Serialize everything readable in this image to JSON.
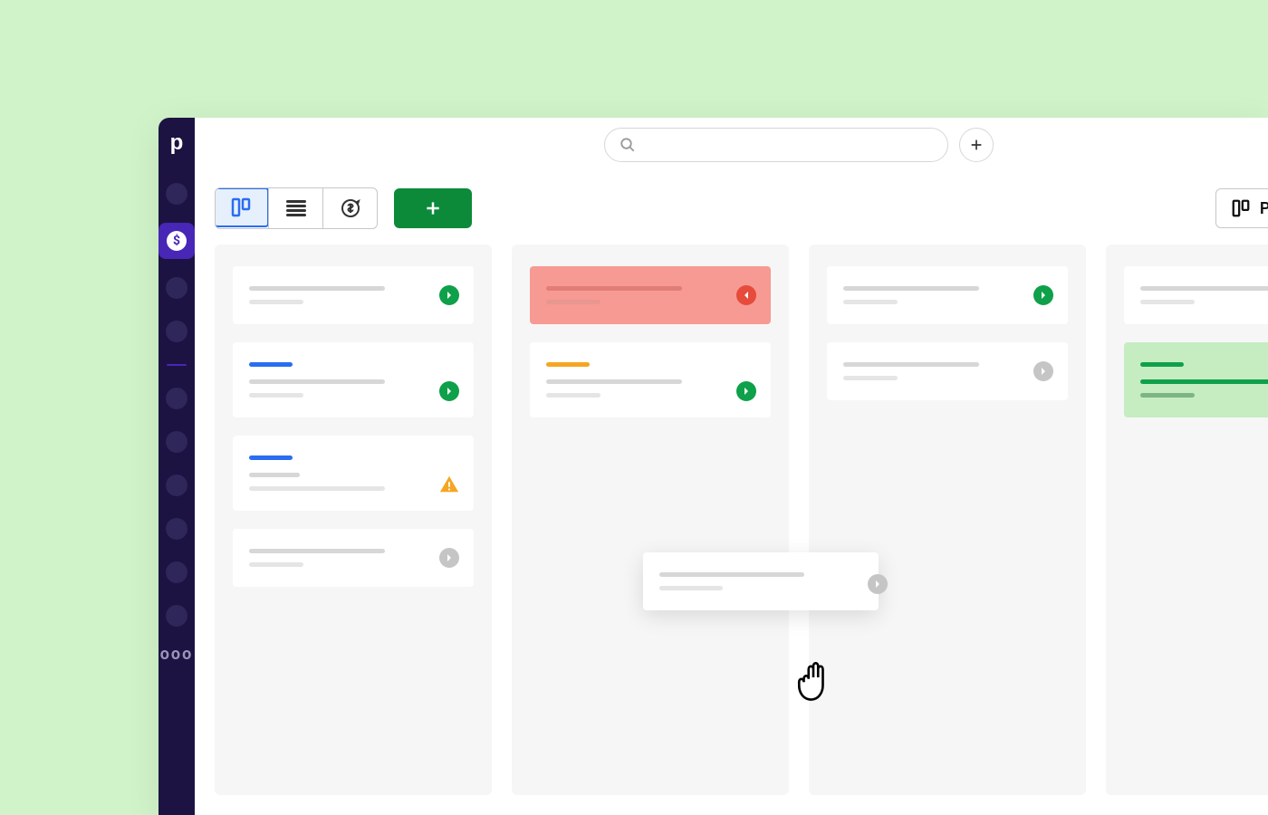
{
  "app": {
    "logo": "p"
  },
  "nav": {
    "active_icon_label": "$",
    "more": "ooo"
  },
  "search": {
    "placeholder": ""
  },
  "toolbar": {
    "pipeline_label": "Pipeline"
  },
  "columns": [
    {
      "cards": [
        {
          "type": "default",
          "title_w": 150,
          "sub_w": 60,
          "badge": "green"
        },
        {
          "type": "default",
          "accent": "blue",
          "title_w": 150,
          "sub_w": 60,
          "badge": "green"
        },
        {
          "type": "default",
          "accent": "blue",
          "title_w": 56,
          "sub_w": 150,
          "warn": true
        },
        {
          "type": "default",
          "title_w": 150,
          "sub_w": 60,
          "badge": "gray"
        }
      ]
    },
    {
      "cards": [
        {
          "type": "red",
          "badge": "red"
        },
        {
          "type": "default",
          "accent": "orange",
          "title_w": 150,
          "sub_w": 60,
          "badge": "green"
        }
      ]
    },
    {
      "cards": [
        {
          "type": "default",
          "title_w": 150,
          "sub_w": 60,
          "badge": "green"
        },
        {
          "type": "default",
          "title_w": 150,
          "sub_w": 60,
          "badge": "gray"
        }
      ]
    },
    {
      "cards": [
        {
          "type": "default",
          "title_w": 150,
          "sub_w": 60
        },
        {
          "type": "green",
          "accent": "green",
          "title_w": 160,
          "sub_w": 60
        }
      ]
    }
  ]
}
